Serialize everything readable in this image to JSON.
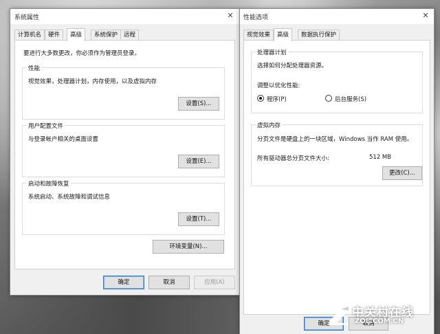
{
  "system_properties": {
    "title": "系统属性",
    "close_icon": "close-icon",
    "tabs": [
      {
        "label": "计算机名"
      },
      {
        "label": "硬件"
      },
      {
        "label": "高级"
      },
      {
        "label": "系统保护"
      },
      {
        "label": "远程"
      }
    ],
    "admin_note": "要进行大多数更改，你必须作为管理员登录。",
    "performance": {
      "label": "性能",
      "description": "视觉效果，处理器计划，内存使用，以及虚拟内存",
      "button": "设置(S)..."
    },
    "user_profiles": {
      "label": "用户配置文件",
      "description": "与登录帐户相关的桌面设置",
      "button": "设置(E)..."
    },
    "startup_recovery": {
      "label": "启动和故障恢复",
      "description": "系统启动、系统故障和调试信息",
      "button": "设置(T)..."
    },
    "env_button": "环境变量(N)...",
    "ok": "确定",
    "cancel": "取消",
    "apply": "应用(A)"
  },
  "performance_options": {
    "title": "性能选项",
    "close_icon": "close-icon",
    "tabs": [
      {
        "label": "视觉效果"
      },
      {
        "label": "高级"
      },
      {
        "label": "数据执行保护"
      }
    ],
    "processor": {
      "label": "处理器计划",
      "description": "选择如何分配处理器资源。",
      "adjust_label": "调整以优化性能:",
      "option_programs": "程序(P)",
      "option_services": "后台服务(S)",
      "selected": "程序(P)"
    },
    "virtual_memory": {
      "label": "虚拟内存",
      "description": "分页文件是硬盘上的一块区域，Windows 当作 RAM 使用。",
      "total_label": "所有驱动器总分页文件大小:",
      "total_value": "512 MB",
      "change_button": "更改(C)..."
    },
    "ok": "确定",
    "cancel_partial": "取消"
  },
  "watermark": {
    "brand": "中关村在线",
    "site": "ZOL.COM.CN"
  }
}
